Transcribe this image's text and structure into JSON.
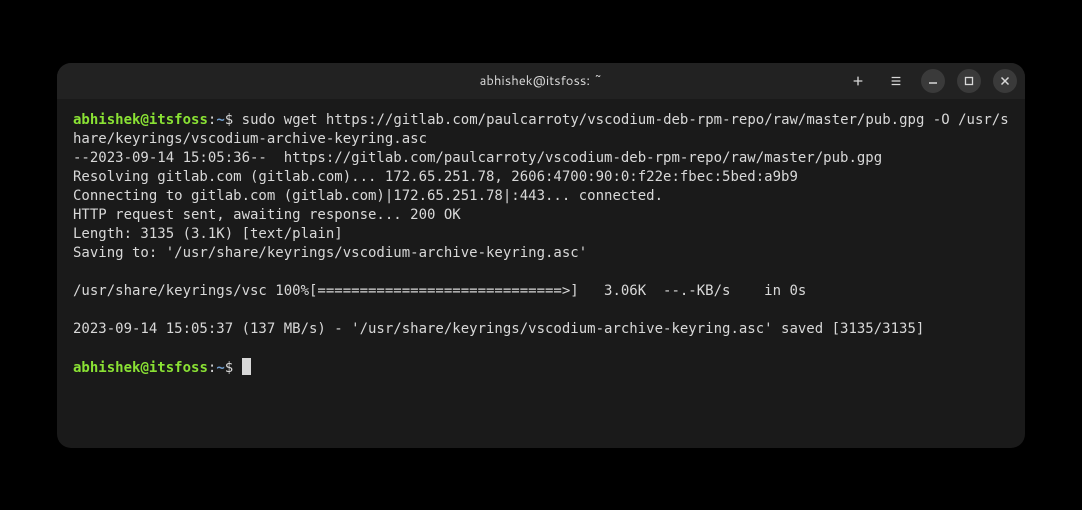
{
  "title": "abhishek@itsfoss: ~",
  "prompt": {
    "user": "abhishek",
    "at": "@",
    "host": "itsfoss",
    "colon": ":",
    "path": "~",
    "dollar": "$"
  },
  "command": "sudo wget https://gitlab.com/paulcarroty/vscodium-deb-rpm-repo/raw/master/pub.gpg -O /usr/share/keyrings/vscodium-archive-keyring.asc",
  "output_lines": [
    "--2023-09-14 15:05:36--  https://gitlab.com/paulcarroty/vscodium-deb-rpm-repo/raw/master/pub.gpg",
    "Resolving gitlab.com (gitlab.com)... 172.65.251.78, 2606:4700:90:0:f22e:fbec:5bed:a9b9",
    "Connecting to gitlab.com (gitlab.com)|172.65.251.78|:443... connected.",
    "HTTP request sent, awaiting response... 200 OK",
    "Length: 3135 (3.1K) [text/plain]",
    "Saving to: '/usr/share/keyrings/vscodium-archive-keyring.asc'",
    "",
    "/usr/share/keyrings/vsc 100%[=============================>]   3.06K  --.-KB/s    in 0s",
    "",
    "2023-09-14 15:05:37 (137 MB/s) - '/usr/share/keyrings/vscodium-archive-keyring.asc' saved [3135/3135]",
    ""
  ]
}
